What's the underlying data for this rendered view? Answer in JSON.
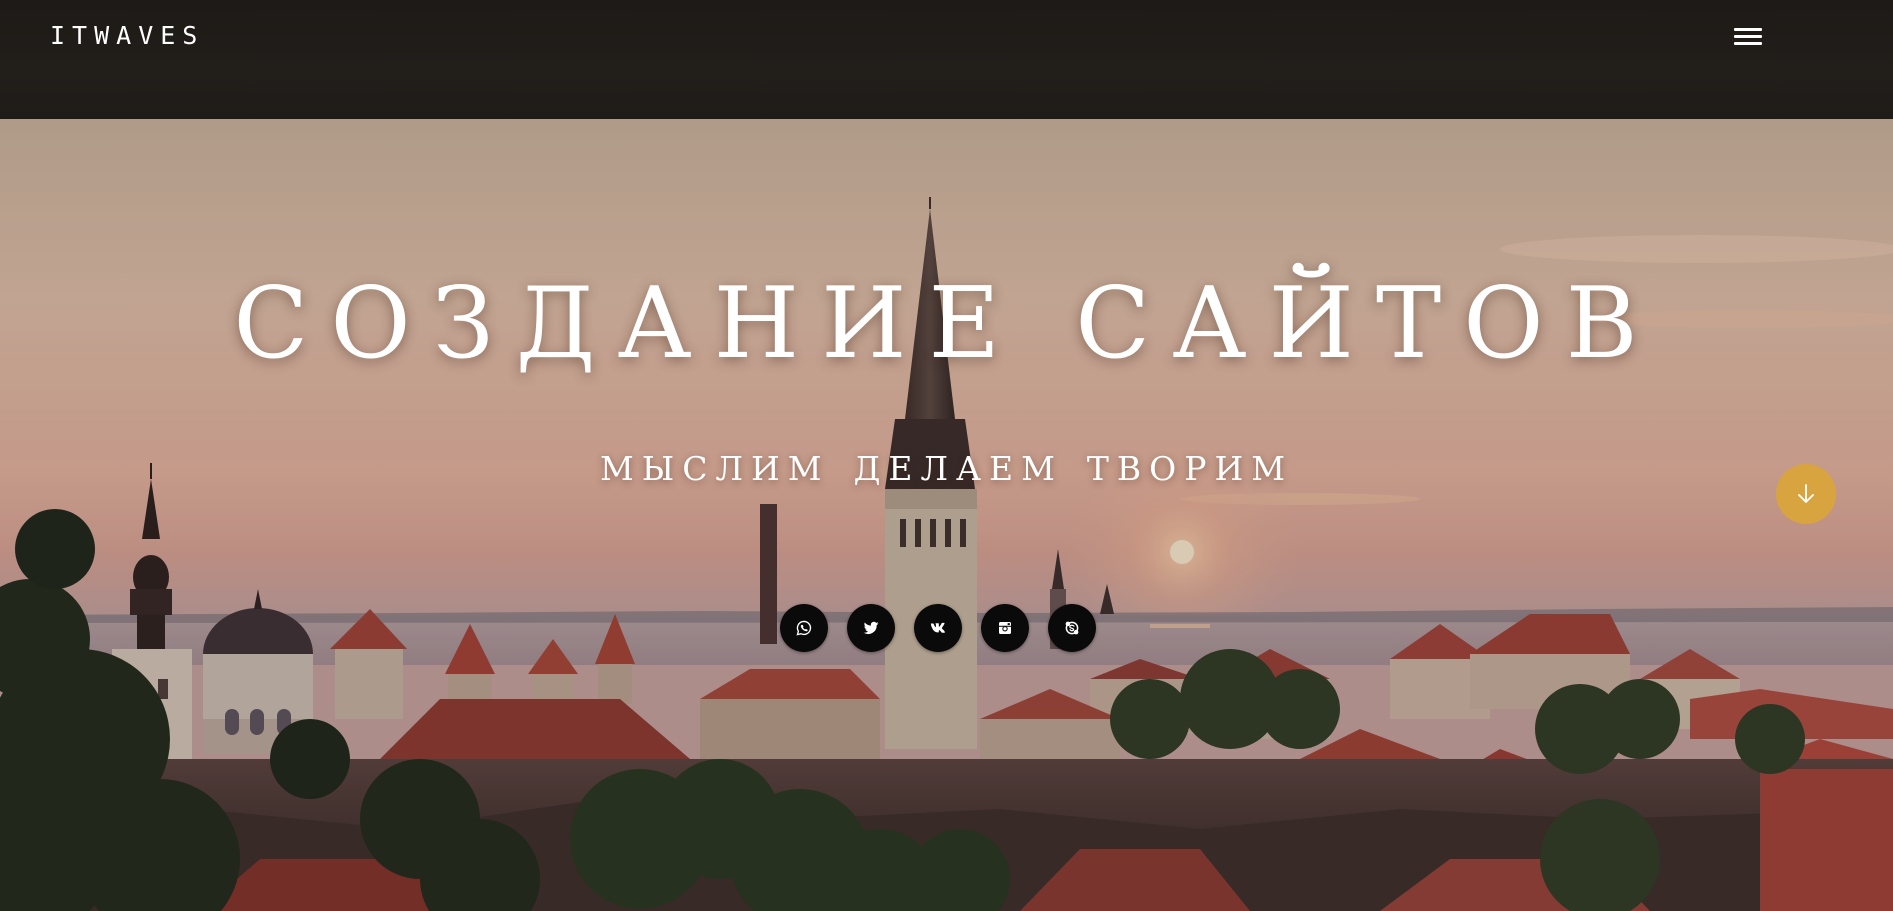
{
  "header": {
    "logo_text": "ITWAVES",
    "menu_icon": "hamburger-menu-icon"
  },
  "hero": {
    "headline": "СОЗДАНИЕ САЙТОВ",
    "tagline_words": [
      "МЫСЛИМ",
      "ДЕЛАЕМ",
      "ТВОРИМ"
    ],
    "background": "sunset-city-skyline-image",
    "scroll_icon": "arrow-down-icon",
    "socials": [
      {
        "name": "whatsapp-icon"
      },
      {
        "name": "twitter-icon"
      },
      {
        "name": "vk-icon"
      },
      {
        "name": "instagram-icon"
      },
      {
        "name": "skype-icon"
      }
    ]
  },
  "colors": {
    "header_bg": "#1d1a17",
    "accent": "#d8a43f",
    "social_bg": "#0b0a0a",
    "text": "#ffffff"
  }
}
